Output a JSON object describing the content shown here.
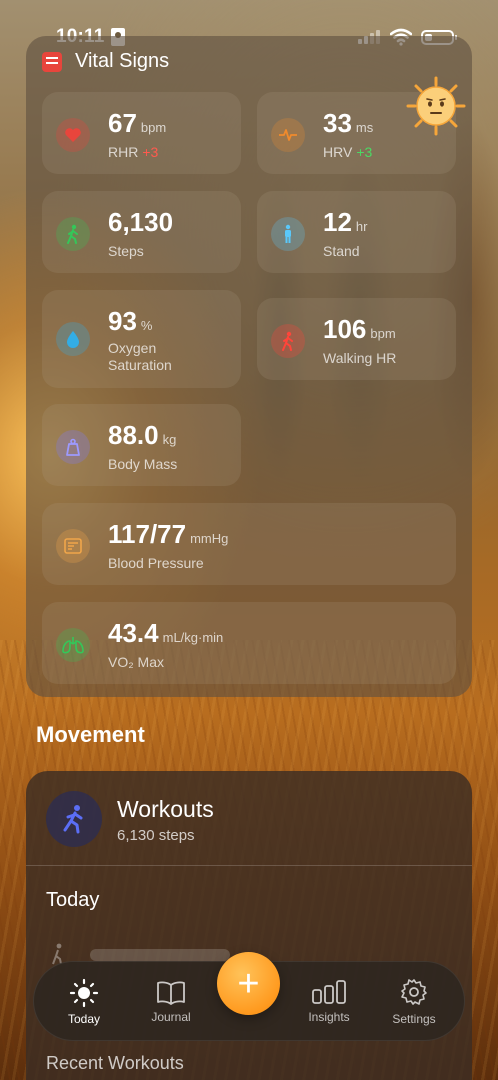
{
  "status_bar": {
    "time": "10:11"
  },
  "vitals": {
    "title": "Vital Signs",
    "tiles": [
      {
        "value": "67",
        "unit": "bpm",
        "label": "RHR",
        "delta": "+3",
        "delta_color": "#ff5a4e",
        "icon": "heart-icon",
        "color": "#e8453c"
      },
      {
        "value": "33",
        "unit": "ms",
        "label": "HRV",
        "delta": "+3",
        "delta_color": "#4cd964",
        "icon": "pulse-icon",
        "color": "#f08a2c"
      },
      {
        "value": "6,130",
        "unit": "",
        "label": "Steps",
        "icon": "walking-icon",
        "color": "#34c759"
      },
      {
        "value": "12",
        "unit": "hr",
        "label": "Stand",
        "icon": "standing-icon",
        "color": "#5ac8fa"
      },
      {
        "value": "93",
        "unit": "%",
        "label_line1": "Oxygen",
        "label_line2": "Saturation",
        "icon": "drop-icon",
        "color": "#32ade6"
      },
      {
        "value": "106",
        "unit": "bpm",
        "label": "Walking HR",
        "icon": "walking-heart-icon",
        "color": "#ff453a"
      },
      {
        "value": "88.0",
        "unit": "kg",
        "label": "Body Mass",
        "icon": "scale-icon",
        "color": "#7d7aff"
      },
      {
        "value": "117/77",
        "unit": "mmHg",
        "label": "Blood Pressure",
        "icon": "blood-pressure-icon",
        "color": "#f0a64a"
      },
      {
        "value": "43.4",
        "unit": "mL/kg·min",
        "label": "VO₂ Max",
        "icon": "lungs-icon",
        "color": "#34c759"
      }
    ]
  },
  "movement": {
    "section_title": "Movement",
    "workouts_title": "Workouts",
    "workouts_sub": "6,130 steps",
    "today_label": "Today",
    "recent_label": "Recent Workouts"
  },
  "tab_bar": {
    "tabs": [
      {
        "label": "Today",
        "icon": "sun-icon",
        "active": true
      },
      {
        "label": "Journal",
        "icon": "book-icon",
        "active": false
      },
      {
        "label": "Insights",
        "icon": "bars-icon",
        "active": false
      },
      {
        "label": "Settings",
        "icon": "gear-icon",
        "active": false
      }
    ],
    "fab_label": "+"
  }
}
